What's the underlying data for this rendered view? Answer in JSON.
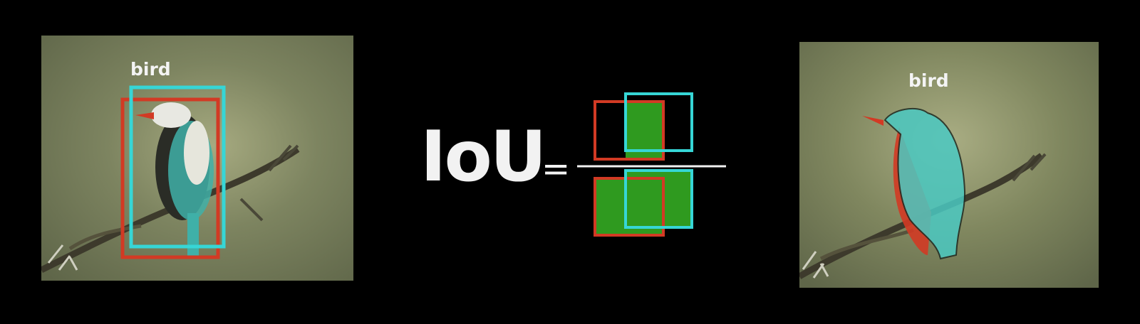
{
  "left_image": {
    "label": "bird",
    "description_icon": "bird-photo"
  },
  "right_image": {
    "label": "bird",
    "description_icon": "bird-photo-segmented"
  },
  "formula": {
    "term": "IoU",
    "operator": "="
  },
  "colors": {
    "prediction": "#d23a24",
    "ground_truth": "#36d6d6",
    "overlap_fill": "#2f9a1f",
    "background": "#000000",
    "text": "#f2f2f2"
  }
}
